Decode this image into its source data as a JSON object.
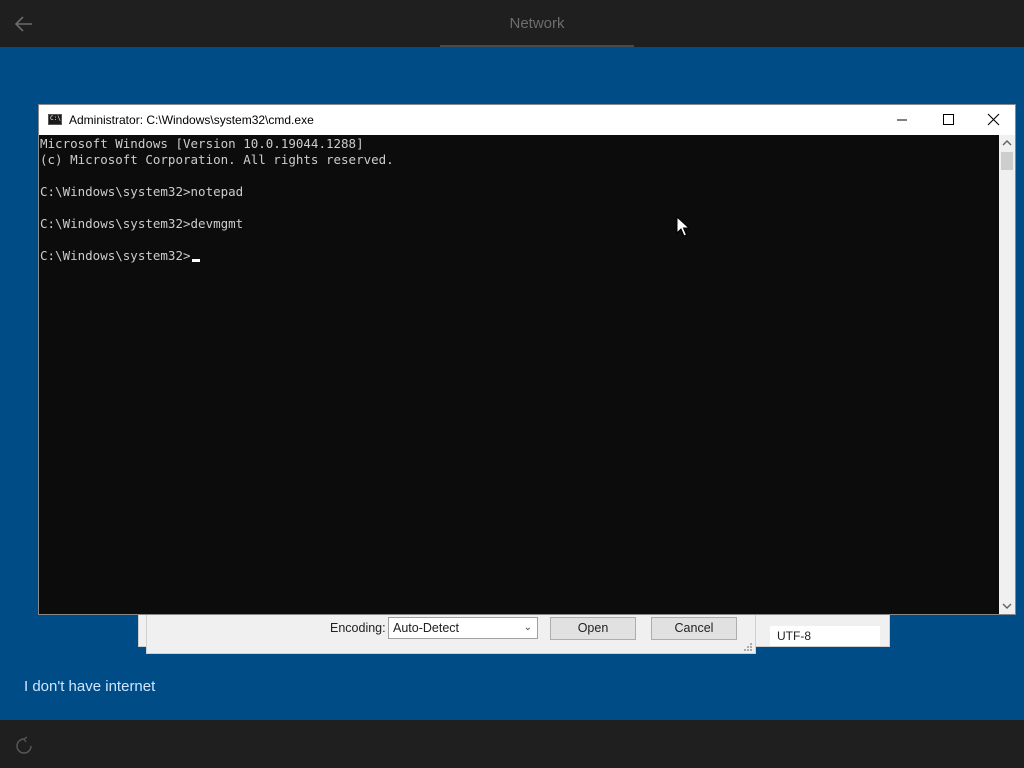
{
  "oobe": {
    "title": "Network",
    "no_internet_link": "I don't have internet"
  },
  "cmd": {
    "title": "Administrator: C:\\Windows\\system32\\cmd.exe",
    "lines": [
      "Microsoft Windows [Version 10.0.19044.1288]",
      "(c) Microsoft Corporation. All rights reserved.",
      "",
      "C:\\Windows\\system32>notepad",
      "",
      "C:\\Windows\\system32>devmgmt",
      "",
      "C:\\Windows\\system32>"
    ]
  },
  "open_dialog": {
    "encoding_label": "Encoding:",
    "encoding_value": "Auto-Detect",
    "open_label": "Open",
    "cancel_label": "Cancel",
    "encoding_field_value": "UTF-8"
  },
  "icons": {
    "back": "back-arrow-icon",
    "accessibility": "accessibility-icon",
    "minimize": "minimize-icon",
    "maximize": "maximize-icon",
    "close": "close-icon"
  },
  "colors": {
    "oobe_background": "#004c87",
    "bar_background": "#1f1f1f",
    "console_background": "#0c0c0c",
    "console_text": "#cccccc"
  }
}
